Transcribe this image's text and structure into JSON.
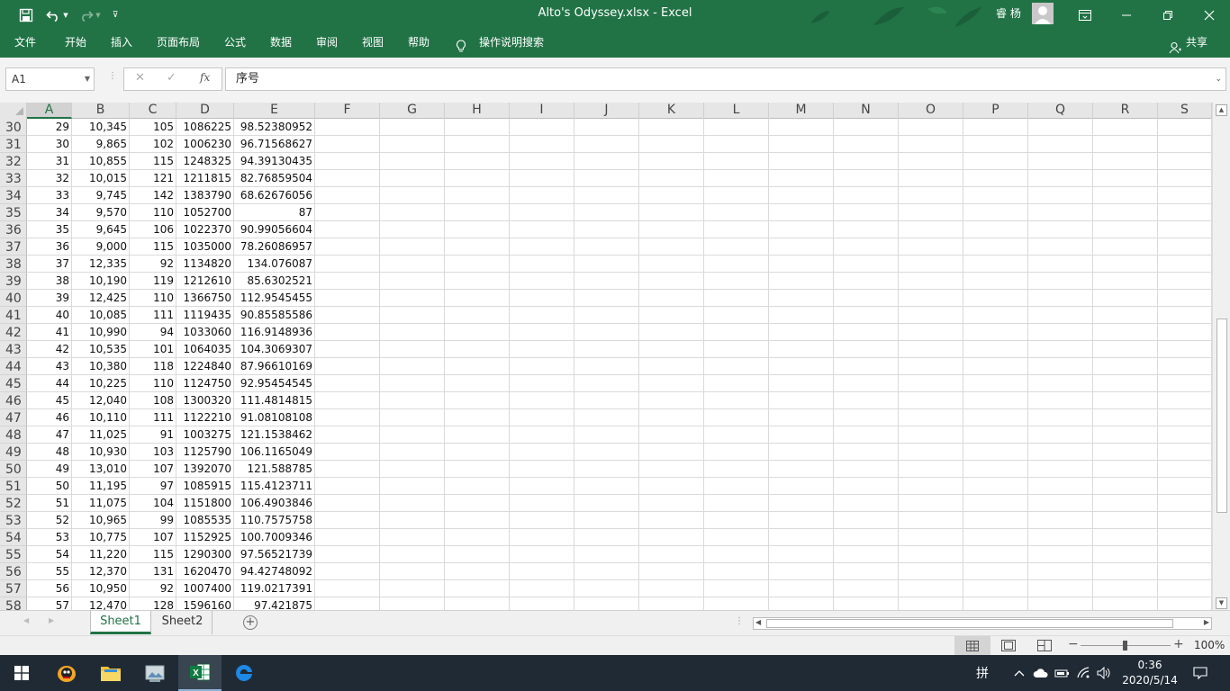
{
  "title_bar": {
    "title": "Alto's Odyssey.xlsx  -  Excel",
    "user_name": "睿 杨"
  },
  "menu": {
    "items": [
      "文件",
      "开始",
      "插入",
      "页面布局",
      "公式",
      "数据",
      "审阅",
      "视图",
      "帮助"
    ],
    "search_label": "操作说明搜索",
    "share_label": "共享"
  },
  "formula_bar": {
    "name_box": "A1",
    "fx_label": "fx",
    "formula": "序号"
  },
  "columns": [
    "A",
    "B",
    "C",
    "D",
    "E",
    "F",
    "G",
    "H",
    "I",
    "J",
    "K",
    "L",
    "M",
    "N",
    "O",
    "P",
    "Q",
    "R",
    "S"
  ],
  "selected_column": "A",
  "rows": [
    {
      "n": "30",
      "a": "29",
      "b": "10,345",
      "c": "105",
      "d": "1086225",
      "e": "98.52380952"
    },
    {
      "n": "31",
      "a": "30",
      "b": "9,865",
      "c": "102",
      "d": "1006230",
      "e": "96.71568627"
    },
    {
      "n": "32",
      "a": "31",
      "b": "10,855",
      "c": "115",
      "d": "1248325",
      "e": "94.39130435"
    },
    {
      "n": "33",
      "a": "32",
      "b": "10,015",
      "c": "121",
      "d": "1211815",
      "e": "82.76859504"
    },
    {
      "n": "34",
      "a": "33",
      "b": "9,745",
      "c": "142",
      "d": "1383790",
      "e": "68.62676056"
    },
    {
      "n": "35",
      "a": "34",
      "b": "9,570",
      "c": "110",
      "d": "1052700",
      "e": "87"
    },
    {
      "n": "36",
      "a": "35",
      "b": "9,645",
      "c": "106",
      "d": "1022370",
      "e": "90.99056604"
    },
    {
      "n": "37",
      "a": "36",
      "b": "9,000",
      "c": "115",
      "d": "1035000",
      "e": "78.26086957"
    },
    {
      "n": "38",
      "a": "37",
      "b": "12,335",
      "c": "92",
      "d": "1134820",
      "e": "134.076087"
    },
    {
      "n": "39",
      "a": "38",
      "b": "10,190",
      "c": "119",
      "d": "1212610",
      "e": "85.6302521"
    },
    {
      "n": "40",
      "a": "39",
      "b": "12,425",
      "c": "110",
      "d": "1366750",
      "e": "112.9545455"
    },
    {
      "n": "41",
      "a": "40",
      "b": "10,085",
      "c": "111",
      "d": "1119435",
      "e": "90.85585586"
    },
    {
      "n": "42",
      "a": "41",
      "b": "10,990",
      "c": "94",
      "d": "1033060",
      "e": "116.9148936"
    },
    {
      "n": "43",
      "a": "42",
      "b": "10,535",
      "c": "101",
      "d": "1064035",
      "e": "104.3069307"
    },
    {
      "n": "44",
      "a": "43",
      "b": "10,380",
      "c": "118",
      "d": "1224840",
      "e": "87.96610169"
    },
    {
      "n": "45",
      "a": "44",
      "b": "10,225",
      "c": "110",
      "d": "1124750",
      "e": "92.95454545"
    },
    {
      "n": "46",
      "a": "45",
      "b": "12,040",
      "c": "108",
      "d": "1300320",
      "e": "111.4814815"
    },
    {
      "n": "47",
      "a": "46",
      "b": "10,110",
      "c": "111",
      "d": "1122210",
      "e": "91.08108108"
    },
    {
      "n": "48",
      "a": "47",
      "b": "11,025",
      "c": "91",
      "d": "1003275",
      "e": "121.1538462"
    },
    {
      "n": "49",
      "a": "48",
      "b": "10,930",
      "c": "103",
      "d": "1125790",
      "e": "106.1165049"
    },
    {
      "n": "50",
      "a": "49",
      "b": "13,010",
      "c": "107",
      "d": "1392070",
      "e": "121.588785"
    },
    {
      "n": "51",
      "a": "50",
      "b": "11,195",
      "c": "97",
      "d": "1085915",
      "e": "115.4123711"
    },
    {
      "n": "52",
      "a": "51",
      "b": "11,075",
      "c": "104",
      "d": "1151800",
      "e": "106.4903846"
    },
    {
      "n": "53",
      "a": "52",
      "b": "10,965",
      "c": "99",
      "d": "1085535",
      "e": "110.7575758"
    },
    {
      "n": "54",
      "a": "53",
      "b": "10,775",
      "c": "107",
      "d": "1152925",
      "e": "100.7009346"
    },
    {
      "n": "55",
      "a": "54",
      "b": "11,220",
      "c": "115",
      "d": "1290300",
      "e": "97.56521739"
    },
    {
      "n": "56",
      "a": "55",
      "b": "12,370",
      "c": "131",
      "d": "1620470",
      "e": "94.42748092"
    },
    {
      "n": "57",
      "a": "56",
      "b": "10,950",
      "c": "92",
      "d": "1007400",
      "e": "119.0217391"
    },
    {
      "n": "58",
      "a": "57",
      "b": "12,470",
      "c": "128",
      "d": "1596160",
      "e": "97.421875"
    }
  ],
  "sheets": {
    "sheet1": "Sheet1",
    "sheet2": "Sheet2"
  },
  "status": {
    "zoom": "100%",
    "zoom_level_fraction": 0.5
  },
  "taskbar": {
    "time": "0:36",
    "date": "2020/5/14",
    "ime": "拼"
  },
  "colors": {
    "excel_green": "#217346",
    "taskbar": "#1f2a35"
  },
  "icons": [
    "save-icon",
    "undo-icon",
    "redo-icon",
    "customize-qat-icon",
    "ribbon-display-icon",
    "minimize-icon",
    "restore-icon",
    "close-icon",
    "lightbulb-icon",
    "share-person-icon",
    "cancel-formula-icon",
    "enter-formula-icon",
    "insert-function-icon",
    "normal-view-icon",
    "page-layout-view-icon",
    "page-break-view-icon",
    "add-sheet-icon",
    "windows-start-icon",
    "file-explorer-icon",
    "excel-app-icon",
    "edge-icon",
    "notification-icon"
  ]
}
